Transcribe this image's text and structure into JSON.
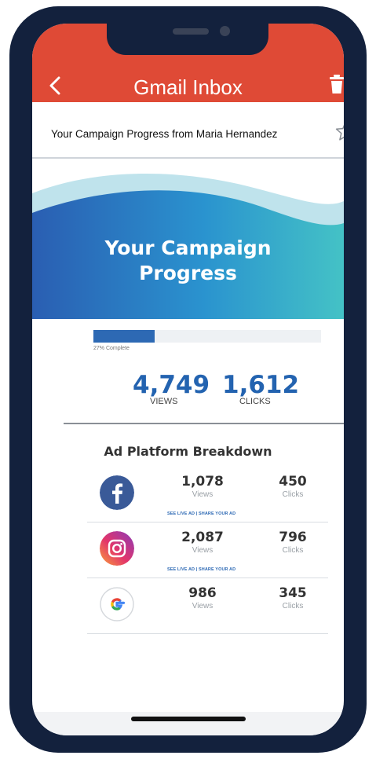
{
  "header": {
    "title": "Gmail Inbox"
  },
  "email": {
    "subject": "Your Campaign Progress from Maria Hernandez"
  },
  "banner": {
    "line1": "Your Campaign",
    "line2": "Progress"
  },
  "progress": {
    "percent": 27,
    "label": "27% Complete"
  },
  "totals": {
    "views": {
      "value": "4,749",
      "label": "VIEWS"
    },
    "clicks": {
      "value": "1,612",
      "label": "CLICKS"
    }
  },
  "breakdown": {
    "title": "Ad Platform Breakdown",
    "platforms": [
      {
        "icon": "facebook-icon",
        "views": "1,078",
        "views_label": "Views",
        "clicks": "450",
        "clicks_label": "Clicks",
        "links": "SEE LIVE AD | SHARE YOUR AD"
      },
      {
        "icon": "instagram-icon",
        "views": "2,087",
        "views_label": "Views",
        "clicks": "796",
        "clicks_label": "Clicks",
        "links": "SEE LIVE AD | SHARE YOUR AD"
      },
      {
        "icon": "google-icon",
        "views": "986",
        "views_label": "Views",
        "clicks": "345",
        "clicks_label": "Clicks"
      }
    ]
  },
  "colors": {
    "header": "#df4a36",
    "phone": "#13213d",
    "accent": "#2363b0"
  }
}
